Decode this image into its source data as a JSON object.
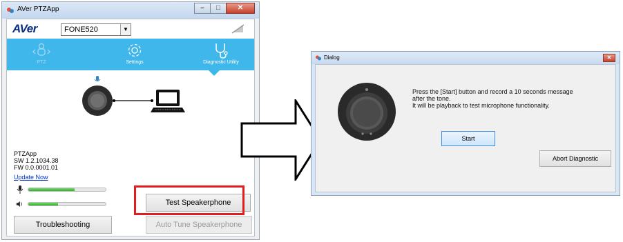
{
  "main_window": {
    "title": "AVer PTZApp",
    "logo": "AVer",
    "model_select": {
      "value": "FONE520"
    },
    "nav": [
      {
        "label": "PTZ",
        "icon": "ptz-icon"
      },
      {
        "label": "Settings",
        "icon": "gear-icon"
      },
      {
        "label": "Diagnostic Utility",
        "icon": "stethoscope-icon"
      }
    ],
    "info": {
      "name": "PTZApp",
      "sw": "SW 1.2.1034.38",
      "fw": "FW 0.0.0001.01",
      "update_link": "Update Now"
    },
    "meters": [
      {
        "icon": "microphone-icon",
        "level": 0.6
      },
      {
        "icon": "speaker-icon",
        "level": 0.38
      }
    ],
    "buttons": {
      "test": "Test Speakerphone",
      "troubleshooting": "Troubleshooting",
      "auto_tune": "Auto Tune Speakerphone"
    }
  },
  "dialog": {
    "title": "Dialog",
    "message_line1": "Press the [Start] button and record a 10 seconds message",
    "message_line2": "after the tone.",
    "message_line3": "It will be playback to test microphone functionality.",
    "start_button": "Start",
    "abort_button": "Abort Diagnostic"
  },
  "colors": {
    "nav_band": "#3fb7ea",
    "highlight": "#e21d1d",
    "meter_fill": "#2fae2b",
    "logo": "#0a2e83"
  }
}
